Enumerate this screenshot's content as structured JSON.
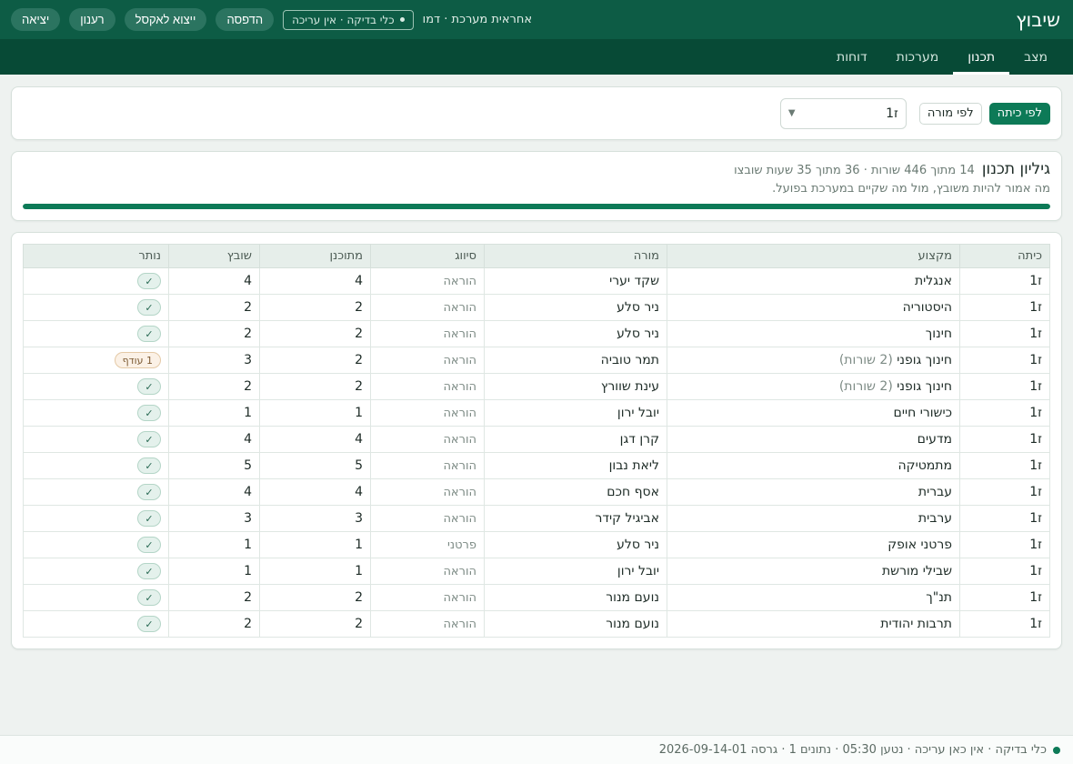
{
  "header": {
    "app_title": "שיבוץ",
    "user_label": "אחראית מערכת · דמו",
    "status_pill": "כלי בדיקה · אין עריכה",
    "buttons": {
      "print": "הדפסה",
      "export_excel": "ייצוא לאקסל",
      "refresh": "רענון",
      "logout": "יציאה"
    },
    "colors": {
      "header_bg": "#0d5c45",
      "nav_bg": "#074a36",
      "accent": "#0d7a57"
    }
  },
  "nav": {
    "tabs": [
      {
        "label": "מצב",
        "active": false
      },
      {
        "label": "תכנון",
        "active": true
      },
      {
        "label": "מערכות",
        "active": false
      },
      {
        "label": "דוחות",
        "active": false
      }
    ]
  },
  "filters": {
    "by_class": "לפי כיתה",
    "by_teacher": "לפי מורה",
    "selected_class": "ז1",
    "active_mode": "by_class"
  },
  "summary": {
    "title": "גיליון תכנון",
    "stats": "14 מתוך 446 שורות · 36 מתוך 35 שעות שובצו",
    "description": "מה אמור להיות משובץ, מול מה שקיים במערכת בפועל.",
    "progress_fraction": 1.0
  },
  "table": {
    "columns": [
      "כיתה",
      "מקצוע",
      "מורה",
      "סיווג",
      "מתוכנן",
      "שובץ",
      "נותר"
    ],
    "rows": [
      {
        "class": "ז1",
        "subject": "אנגלית",
        "note": "",
        "teacher": "שקד יערי",
        "type": "הוראה",
        "planned": "4",
        "assigned": "4",
        "status": "✓",
        "status_kind": "ok"
      },
      {
        "class": "ז1",
        "subject": "היסטוריה",
        "note": "",
        "teacher": "ניר סלע",
        "type": "הוראה",
        "planned": "2",
        "assigned": "2",
        "status": "✓",
        "status_kind": "ok"
      },
      {
        "class": "ז1",
        "subject": "חינוך",
        "note": "",
        "teacher": "ניר סלע",
        "type": "הוראה",
        "planned": "2",
        "assigned": "2",
        "status": "✓",
        "status_kind": "ok"
      },
      {
        "class": "ז1",
        "subject": "חינוך גופני",
        "note": "(2 שורות)",
        "teacher": "תמר טוביה",
        "type": "הוראה",
        "planned": "2",
        "assigned": "3",
        "status": "1 עודף",
        "status_kind": "warn"
      },
      {
        "class": "ז1",
        "subject": "חינוך גופני",
        "note": "(2 שורות)",
        "teacher": "עינת שוורץ",
        "type": "הוראה",
        "planned": "2",
        "assigned": "2",
        "status": "✓",
        "status_kind": "ok"
      },
      {
        "class": "ז1",
        "subject": "כישורי חיים",
        "note": "",
        "teacher": "יובל ירון",
        "type": "הוראה",
        "planned": "1",
        "assigned": "1",
        "status": "✓",
        "status_kind": "ok"
      },
      {
        "class": "ז1",
        "subject": "מדעים",
        "note": "",
        "teacher": "קרן דגן",
        "type": "הוראה",
        "planned": "4",
        "assigned": "4",
        "status": "✓",
        "status_kind": "ok"
      },
      {
        "class": "ז1",
        "subject": "מתמטיקה",
        "note": "",
        "teacher": "ליאת נבון",
        "type": "הוראה",
        "planned": "5",
        "assigned": "5",
        "status": "✓",
        "status_kind": "ok"
      },
      {
        "class": "ז1",
        "subject": "עברית",
        "note": "",
        "teacher": "אסף חכם",
        "type": "הוראה",
        "planned": "4",
        "assigned": "4",
        "status": "✓",
        "status_kind": "ok"
      },
      {
        "class": "ז1",
        "subject": "ערבית",
        "note": "",
        "teacher": "אביגיל קידר",
        "type": "הוראה",
        "planned": "3",
        "assigned": "3",
        "status": "✓",
        "status_kind": "ok"
      },
      {
        "class": "ז1",
        "subject": "פרטני אופק",
        "note": "",
        "teacher": "ניר סלע",
        "type": "פרטני",
        "planned": "1",
        "assigned": "1",
        "status": "✓",
        "status_kind": "ok"
      },
      {
        "class": "ז1",
        "subject": "שבילי מורשת",
        "note": "",
        "teacher": "יובל ירון",
        "type": "הוראה",
        "planned": "1",
        "assigned": "1",
        "status": "✓",
        "status_kind": "ok"
      },
      {
        "class": "ז1",
        "subject": "תנ\"ך",
        "note": "",
        "teacher": "נועם מנור",
        "type": "הוראה",
        "planned": "2",
        "assigned": "2",
        "status": "✓",
        "status_kind": "ok"
      },
      {
        "class": "ז1",
        "subject": "תרבות יהודית",
        "note": "",
        "teacher": "נועם מנור",
        "type": "הוראה",
        "planned": "2",
        "assigned": "2",
        "status": "✓",
        "status_kind": "ok"
      }
    ]
  },
  "footer": {
    "text": "כלי בדיקה · אין כאן עריכה · נטען 05:30 · נתונים 1 · גרסה 2026-09-14-01"
  }
}
